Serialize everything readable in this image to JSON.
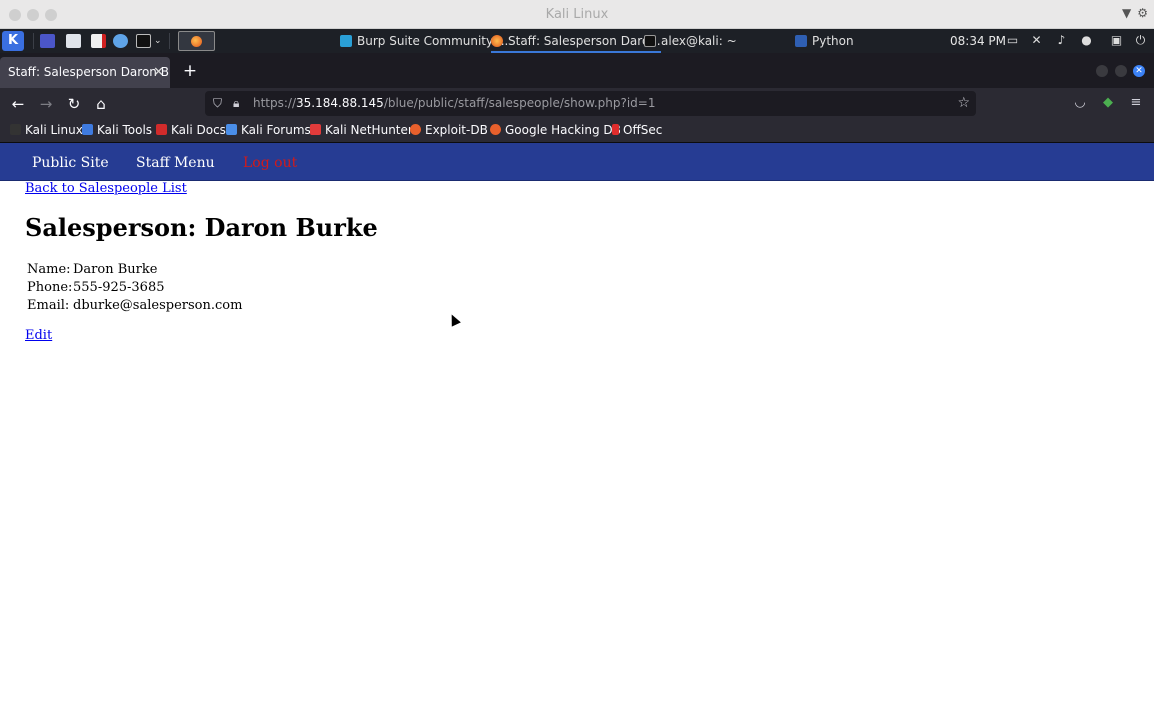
{
  "window": {
    "title": "Kali Linux"
  },
  "panel": {
    "taskbar": [
      {
        "label": "Burp Suite Community ...",
        "icon": "burp-icon"
      },
      {
        "label": "Staff: Salesperson Daro...",
        "icon": "firefox-icon",
        "active": true
      },
      {
        "label": "alex@kali: ~",
        "icon": "terminal-icon"
      },
      {
        "label": "Python",
        "icon": "folder-icon"
      }
    ],
    "clock": "08:34 PM"
  },
  "browser": {
    "tab_title": "Staff: Salesperson Daron Burke",
    "url_host": "35.184.88.145",
    "url_prefix": "https://",
    "url_path": "/blue/public/staff/salespeople/show.php?id=1"
  },
  "bookmarks": [
    {
      "label": "Kali Linux",
      "color": "#1a1a1a"
    },
    {
      "label": "Kali Tools",
      "color": "#3f7be0"
    },
    {
      "label": "Kali Docs",
      "color": "#d12b2b"
    },
    {
      "label": "Kali Forums",
      "color": "#4a8ee8"
    },
    {
      "label": "Kali NetHunter",
      "color": "#e23b3b"
    },
    {
      "label": "Exploit-DB",
      "color": "#e8602c"
    },
    {
      "label": "Google Hacking DB",
      "color": "#e8602c"
    },
    {
      "label": "OffSec",
      "color": "#e02d2d"
    }
  ],
  "site": {
    "nav": {
      "public_site": "Public Site",
      "staff_menu": "Staff Menu",
      "log_out": "Log out"
    },
    "back_link": "Back to Salespeople List",
    "heading": "Salesperson: Daron Burke",
    "details": [
      {
        "label": "Name:",
        "value": "Daron Burke"
      },
      {
        "label": "Phone:",
        "value": "555-925-3685"
      },
      {
        "label": "Email:",
        "value": "dburke@salesperson.com"
      }
    ],
    "edit_link": "Edit"
  }
}
